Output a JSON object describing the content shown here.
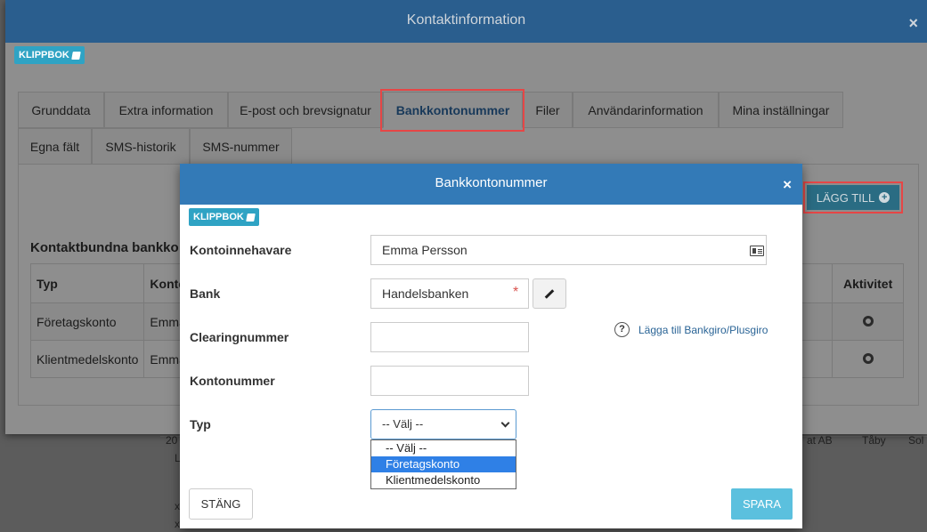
{
  "outer_dialog": {
    "title": "Kontaktinformation",
    "close": "×",
    "klippbok": "KLIPPBOK",
    "tabs_row1": [
      "Grunddata",
      "Extra information",
      "E-post och brevsignatur",
      "Bankkontonummer",
      "Filer",
      "Användarinformation",
      "Mina inställningar"
    ],
    "tabs_row2": [
      "Egna fält",
      "SMS-historik",
      "SMS-nummer"
    ],
    "active_tab": "Bankkontonummer",
    "add_button": "LÄGG TILL",
    "section_title": "Kontaktbundna bankko",
    "table": {
      "headers": [
        "Typ",
        "Konto",
        "Aktivitet"
      ],
      "rows": [
        {
          "typ": "Företagskonto",
          "konto": "Emma"
        },
        {
          "typ": "Klientmedelskonto",
          "konto": "Emma"
        }
      ]
    }
  },
  "background": {
    "fragments": [
      "20",
      "L",
      "x",
      "x",
      "Tåby",
      "Sol",
      "at AB"
    ]
  },
  "modal": {
    "title": "Bankkontonummer",
    "close": "×",
    "klippbok": "KLIPPBOK",
    "fields": {
      "kontoinnehavare": {
        "label": "Kontoinnehavare",
        "value": "Emma Persson"
      },
      "bank": {
        "label": "Bank",
        "value": "Handelsbanken",
        "required": "*"
      },
      "clearingnummer": {
        "label": "Clearingnummer",
        "value": ""
      },
      "kontonummer": {
        "label": "Kontonummer",
        "value": ""
      },
      "typ": {
        "label": "Typ",
        "value": "-- Välj --",
        "options": [
          "-- Välj --",
          "Företagskonto",
          "Klientmedelskonto"
        ],
        "highlighted": "Företagskonto"
      }
    },
    "help_link": "Lägga till Bankgiro/Plusgiro",
    "help_icon": "?",
    "buttons": {
      "close": "STÄNG",
      "save": "SPARA"
    }
  },
  "colors": {
    "header": "#337ab7",
    "accent": "#5bc0de",
    "highlight": "#e64646"
  }
}
